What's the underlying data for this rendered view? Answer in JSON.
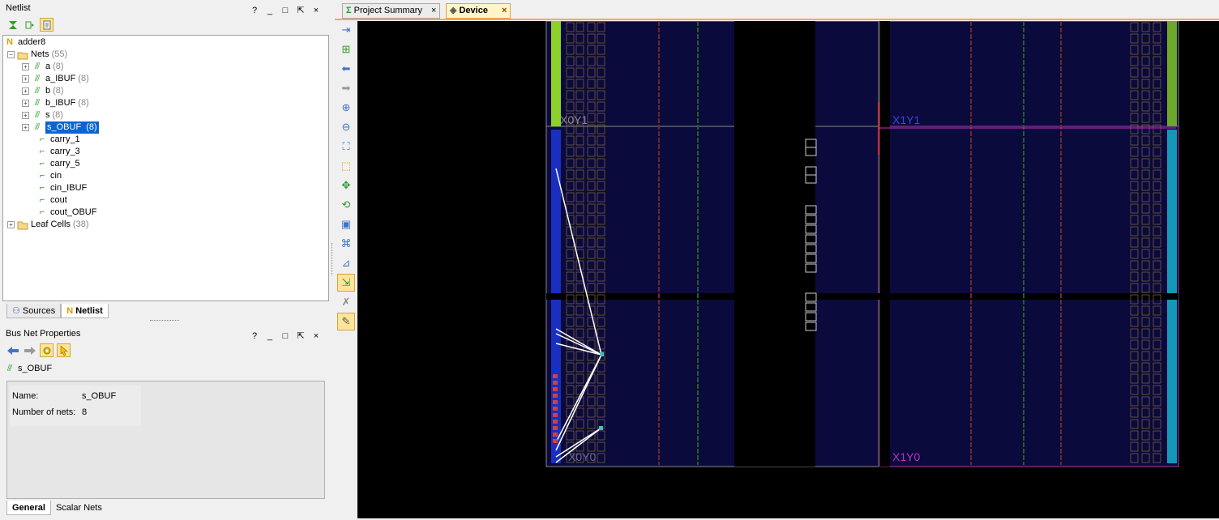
{
  "netlist_panel": {
    "title": "Netlist",
    "window_buttons": [
      "?",
      "_",
      "□",
      "⇱",
      "×"
    ],
    "tree": {
      "root": "adder8",
      "nets_label": "Nets",
      "nets_count": "(55)",
      "bus_nets": [
        {
          "name": "a",
          "count": "(8)"
        },
        {
          "name": "a_IBUF",
          "count": "(8)"
        },
        {
          "name": "b",
          "count": "(8)"
        },
        {
          "name": "b_IBUF",
          "count": "(8)"
        },
        {
          "name": "s",
          "count": "(8)"
        },
        {
          "name": "s_OBUF",
          "count": "(8)"
        }
      ],
      "scalar_nets": [
        "carry_1",
        "carry_3",
        "carry_5",
        "cin",
        "cin_IBUF",
        "cout",
        "cout_OBUF"
      ],
      "leaf_label": "Leaf Cells",
      "leaf_count": "(38)"
    },
    "tabs": [
      {
        "label": "Sources"
      },
      {
        "label": "Netlist"
      }
    ]
  },
  "properties_panel": {
    "title": "Bus Net Properties",
    "window_buttons": [
      "?",
      "_",
      "□",
      "⇱",
      "×"
    ],
    "object_name": "s_OBUF",
    "fields": [
      {
        "label": "Name:",
        "value": "s_OBUF"
      },
      {
        "label": "Number of nets:",
        "value": "8"
      }
    ],
    "tabs": [
      {
        "label": "General"
      },
      {
        "label": "Scalar Nets"
      }
    ]
  },
  "editor_tabs": [
    {
      "label": "Project Summary",
      "icon": "sigma-icon"
    },
    {
      "label": "Device",
      "icon": "device-icon"
    }
  ],
  "device_view": {
    "clock_regions": [
      "X0Y1",
      "X1Y1",
      "X0Y0",
      "X1Y0"
    ],
    "colors": {
      "background": "#000000",
      "region_fill": "#0a0a3c",
      "io_green": "#8ed12a",
      "io_blue": "#1a2fbf",
      "io_cyan": "#1598b8",
      "highlight_net": "#ffffff",
      "region_label_blue": "#3a48d8",
      "region_label_magenta": "#c030c0"
    }
  }
}
